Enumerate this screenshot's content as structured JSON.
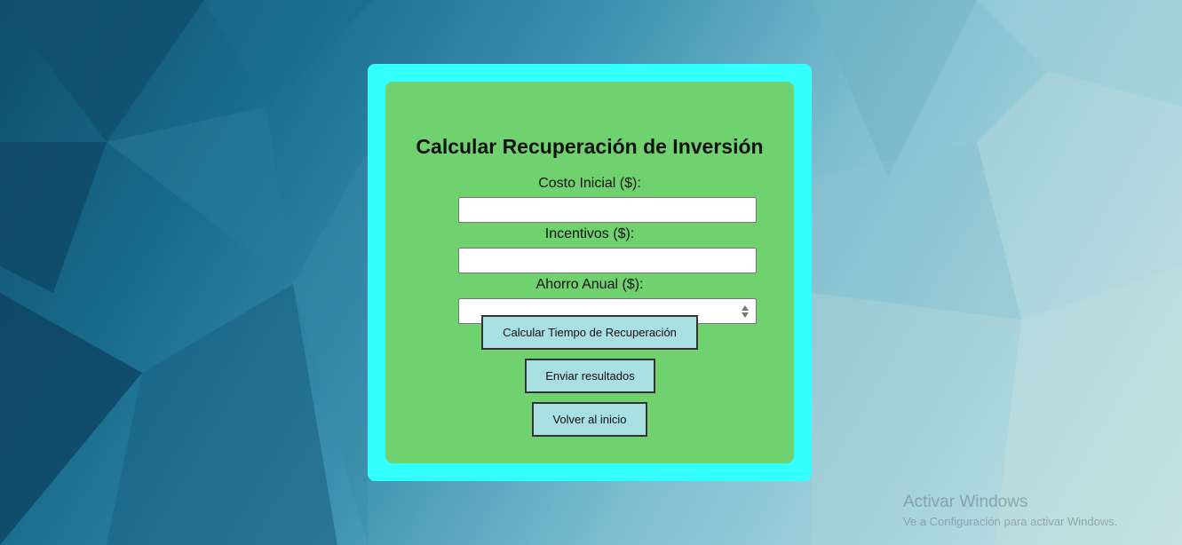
{
  "form": {
    "title": "Calcular Recuperación de Inversión",
    "fields": [
      {
        "label": "Costo Inicial ($):",
        "value": ""
      },
      {
        "label": "Incentivos ($):",
        "value": ""
      },
      {
        "label": "Ahorro Anual ($):",
        "value": ""
      }
    ],
    "buttons": {
      "calculate": "Calcular Tiempo de Recuperación",
      "send": "Enviar resultados",
      "home": "Volver al inicio"
    }
  },
  "watermark": {
    "title": "Activar Windows",
    "subtitle": "Ve a Configuración para activar Windows."
  },
  "colors": {
    "frame": "#33ffff",
    "card": "#6fd26f",
    "button": "#a8dfe0"
  }
}
